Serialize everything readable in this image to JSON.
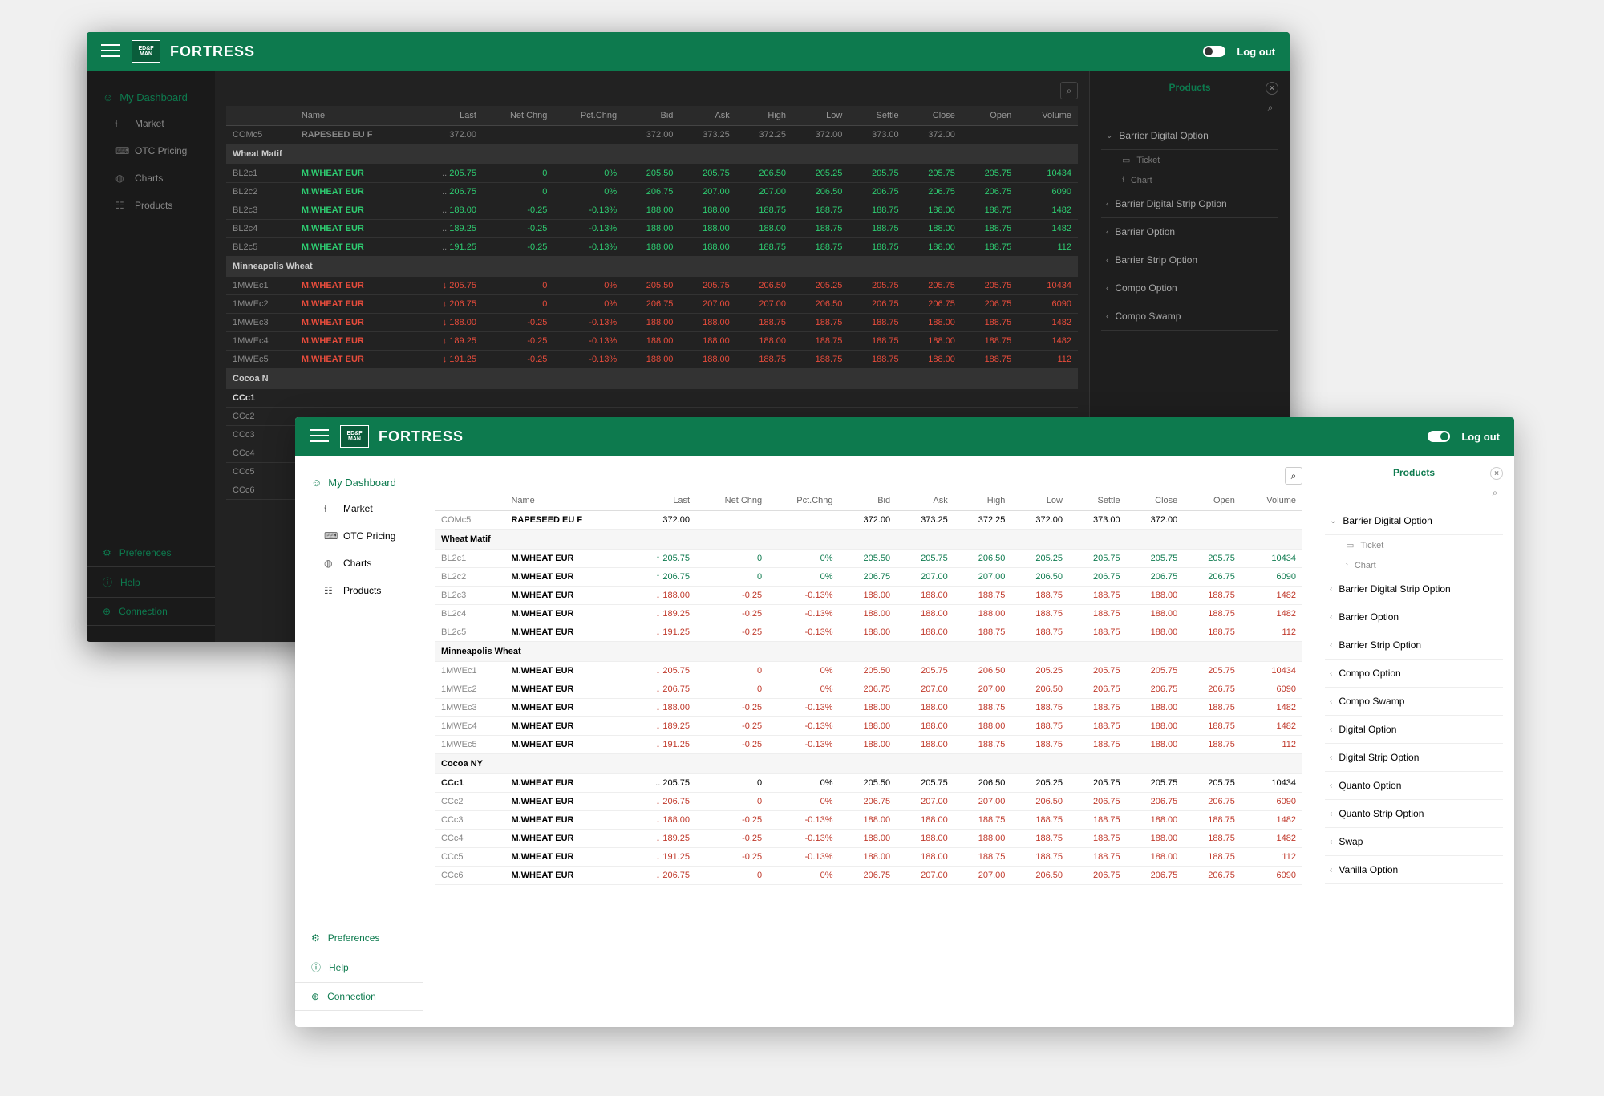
{
  "app": {
    "title": "FORTRESS",
    "logo": "ED&F MAN",
    "logout": "Log out"
  },
  "sidebar": {
    "dashboard": "My Dashboard",
    "items": [
      {
        "icon": "chart-bar",
        "label": "Market"
      },
      {
        "icon": "calculator",
        "label": "OTC Pricing"
      },
      {
        "icon": "globe",
        "label": "Charts"
      },
      {
        "icon": "stats",
        "label": "Products"
      }
    ],
    "bottom": [
      {
        "icon": "gear",
        "label": "Preferences"
      },
      {
        "icon": "info",
        "label": "Help"
      },
      {
        "icon": "plus",
        "label": "Connection"
      }
    ]
  },
  "columns": [
    "Name",
    "Last",
    "Net Chng",
    "Pct.Chng",
    "Bid",
    "Ask",
    "High",
    "Low",
    "Settle",
    "Close",
    "Open",
    "Volume"
  ],
  "top_row": {
    "code": "COMc5",
    "name": "RAPESEED EU F",
    "last": "372.00",
    "bid": "372.00",
    "ask": "373.25",
    "high": "372.25",
    "low": "372.00",
    "settle": "373.00",
    "close": "372.00"
  },
  "groups": [
    {
      "name": "Wheat Matif",
      "rows": [
        {
          "code": "BL2c1",
          "name": "M.WHEAT EUR",
          "dir": "up",
          "last": "205.75",
          "nchg": "0",
          "pchg": "0%",
          "bid": "205.50",
          "ask": "205.75",
          "high": "206.50",
          "low": "205.25",
          "settle": "205.75",
          "close": "205.75",
          "open": "205.75",
          "vol": "10434",
          "cls": "pos"
        },
        {
          "code": "BL2c2",
          "name": "M.WHEAT EUR",
          "dir": "up",
          "last": "206.75",
          "nchg": "0",
          "pchg": "0%",
          "bid": "206.75",
          "ask": "207.00",
          "high": "207.00",
          "low": "206.50",
          "settle": "206.75",
          "close": "206.75",
          "open": "206.75",
          "vol": "6090",
          "cls": "pos"
        },
        {
          "code": "BL2c3",
          "name": "M.WHEAT EUR",
          "dir": "dn",
          "last": "188.00",
          "nchg": "-0.25",
          "pchg": "-0.13%",
          "bid": "188.00",
          "ask": "188.00",
          "high": "188.75",
          "low": "188.75",
          "settle": "188.75",
          "close": "188.00",
          "open": "188.75",
          "vol": "1482",
          "cls": "neg"
        },
        {
          "code": "BL2c4",
          "name": "M.WHEAT EUR",
          "dir": "dn",
          "last": "189.25",
          "nchg": "-0.25",
          "pchg": "-0.13%",
          "bid": "188.00",
          "ask": "188.00",
          "high": "188.00",
          "low": "188.75",
          "settle": "188.75",
          "close": "188.00",
          "open": "188.75",
          "vol": "1482",
          "cls": "neg"
        },
        {
          "code": "BL2c5",
          "name": "M.WHEAT EUR",
          "dir": "dn",
          "last": "191.25",
          "nchg": "-0.25",
          "pchg": "-0.13%",
          "bid": "188.00",
          "ask": "188.00",
          "high": "188.75",
          "low": "188.75",
          "settle": "188.75",
          "close": "188.00",
          "open": "188.75",
          "vol": "112",
          "cls": "neg"
        }
      ]
    },
    {
      "name": "Minneapolis Wheat",
      "rows": [
        {
          "code": "1MWEc1",
          "name": "M.WHEAT EUR",
          "dir": "dn",
          "last": "205.75",
          "nchg": "0",
          "pchg": "0%",
          "bid": "205.50",
          "ask": "205.75",
          "high": "206.50",
          "low": "205.25",
          "settle": "205.75",
          "close": "205.75",
          "open": "205.75",
          "vol": "10434",
          "cls": "neg"
        },
        {
          "code": "1MWEc2",
          "name": "M.WHEAT EUR",
          "dir": "dn",
          "last": "206.75",
          "nchg": "0",
          "pchg": "0%",
          "bid": "206.75",
          "ask": "207.00",
          "high": "207.00",
          "low": "206.50",
          "settle": "206.75",
          "close": "206.75",
          "open": "206.75",
          "vol": "6090",
          "cls": "neg"
        },
        {
          "code": "1MWEc3",
          "name": "M.WHEAT EUR",
          "dir": "dn",
          "last": "188.00",
          "nchg": "-0.25",
          "pchg": "-0.13%",
          "bid": "188.00",
          "ask": "188.00",
          "high": "188.75",
          "low": "188.75",
          "settle": "188.75",
          "close": "188.00",
          "open": "188.75",
          "vol": "1482",
          "cls": "neg"
        },
        {
          "code": "1MWEc4",
          "name": "M.WHEAT EUR",
          "dir": "dn",
          "last": "189.25",
          "nchg": "-0.25",
          "pchg": "-0.13%",
          "bid": "188.00",
          "ask": "188.00",
          "high": "188.00",
          "low": "188.75",
          "settle": "188.75",
          "close": "188.00",
          "open": "188.75",
          "vol": "1482",
          "cls": "neg"
        },
        {
          "code": "1MWEc5",
          "name": "M.WHEAT EUR",
          "dir": "dn",
          "last": "191.25",
          "nchg": "-0.25",
          "pchg": "-0.13%",
          "bid": "188.00",
          "ask": "188.00",
          "high": "188.75",
          "low": "188.75",
          "settle": "188.75",
          "close": "188.00",
          "open": "188.75",
          "vol": "112",
          "cls": "neg"
        }
      ]
    },
    {
      "name": "Cocoa NY",
      "rows": [
        {
          "code": "CCc1",
          "name": "M.WHEAT EUR",
          "dir": "",
          "last": "205.75",
          "nchg": "0",
          "pchg": "0%",
          "bid": "205.50",
          "ask": "205.75",
          "high": "206.50",
          "low": "205.25",
          "settle": "205.75",
          "close": "205.75",
          "open": "205.75",
          "vol": "10434",
          "cls": "",
          "bold": true
        },
        {
          "code": "CCc2",
          "name": "M.WHEAT EUR",
          "dir": "dn",
          "last": "206.75",
          "nchg": "0",
          "pchg": "0%",
          "bid": "206.75",
          "ask": "207.00",
          "high": "207.00",
          "low": "206.50",
          "settle": "206.75",
          "close": "206.75",
          "open": "206.75",
          "vol": "6090",
          "cls": "neg"
        },
        {
          "code": "CCc3",
          "name": "M.WHEAT EUR",
          "dir": "dn",
          "last": "188.00",
          "nchg": "-0.25",
          "pchg": "-0.13%",
          "bid": "188.00",
          "ask": "188.00",
          "high": "188.75",
          "low": "188.75",
          "settle": "188.75",
          "close": "188.00",
          "open": "188.75",
          "vol": "1482",
          "cls": "neg"
        },
        {
          "code": "CCc4",
          "name": "M.WHEAT EUR",
          "dir": "dn",
          "last": "189.25",
          "nchg": "-0.25",
          "pchg": "-0.13%",
          "bid": "188.00",
          "ask": "188.00",
          "high": "188.00",
          "low": "188.75",
          "settle": "188.75",
          "close": "188.00",
          "open": "188.75",
          "vol": "1482",
          "cls": "neg"
        },
        {
          "code": "CCc5",
          "name": "M.WHEAT EUR",
          "dir": "dn",
          "last": "191.25",
          "nchg": "-0.25",
          "pchg": "-0.13%",
          "bid": "188.00",
          "ask": "188.00",
          "high": "188.75",
          "low": "188.75",
          "settle": "188.75",
          "close": "188.00",
          "open": "188.75",
          "vol": "112",
          "cls": "neg"
        },
        {
          "code": "CCc6",
          "name": "M.WHEAT EUR",
          "dir": "dn",
          "last": "206.75",
          "nchg": "0",
          "pchg": "0%",
          "bid": "206.75",
          "ask": "207.00",
          "high": "207.00",
          "low": "206.50",
          "settle": "206.75",
          "close": "206.75",
          "open": "206.75",
          "vol": "6090",
          "cls": "neg"
        }
      ]
    }
  ],
  "dark_groups_limit": 2,
  "dark_extra_rows": [
    "CCc1",
    "CCc2",
    "CCc3",
    "CCc4",
    "CCc5",
    "CCc6"
  ],
  "dark_extra_group": "Cocoa N",
  "products": {
    "title": "Products",
    "expanded": {
      "label": "Barrier Digital Option",
      "subs": [
        {
          "icon": "ticket",
          "label": "Ticket"
        },
        {
          "icon": "chart",
          "label": "Chart"
        }
      ]
    },
    "items": [
      "Barrier Digital Strip Option",
      "Barrier Option",
      "Barrier Strip Option",
      "Compo Option",
      "Compo Swamp",
      "Digital Option",
      "Digital Strip Option",
      "Quanto Option",
      "Quanto Strip Option",
      "Swap",
      "Vanilla Option"
    ]
  },
  "dark_products_limit": 5
}
